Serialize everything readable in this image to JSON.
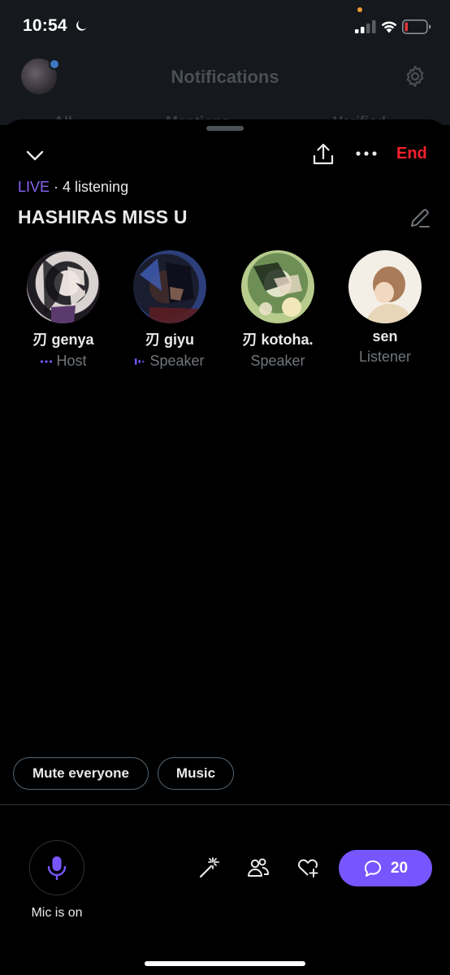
{
  "status_bar": {
    "time": "10:54",
    "icons": [
      "moon-icon",
      "signal-icon",
      "wifi-icon",
      "battery-icon"
    ],
    "battery_color": "#e0393e"
  },
  "background": {
    "title": "Notifications",
    "tabs": [
      "All",
      "Mentions",
      "Verified"
    ]
  },
  "space": {
    "live_label": "LIVE",
    "listening_text": " · 4 listening",
    "title": "HASHIRAS MISS U",
    "end_label": "End",
    "accent": "#7856ff",
    "end_color": "#f4212e"
  },
  "participants": [
    {
      "name": "刃 genya",
      "role": "Host",
      "role_icon": "dots-icon"
    },
    {
      "name": "刃 giyu",
      "role": "Speaker",
      "role_icon": "speaking-bars-icon"
    },
    {
      "name": "刃 kotoha.",
      "role": "Speaker",
      "role_icon": ""
    },
    {
      "name": "sen",
      "role": "Listener",
      "role_icon": ""
    }
  ],
  "controls": {
    "mute_everyone": "Mute everyone",
    "music": "Music",
    "mic_label": "Mic is on",
    "comment_count": "20"
  }
}
